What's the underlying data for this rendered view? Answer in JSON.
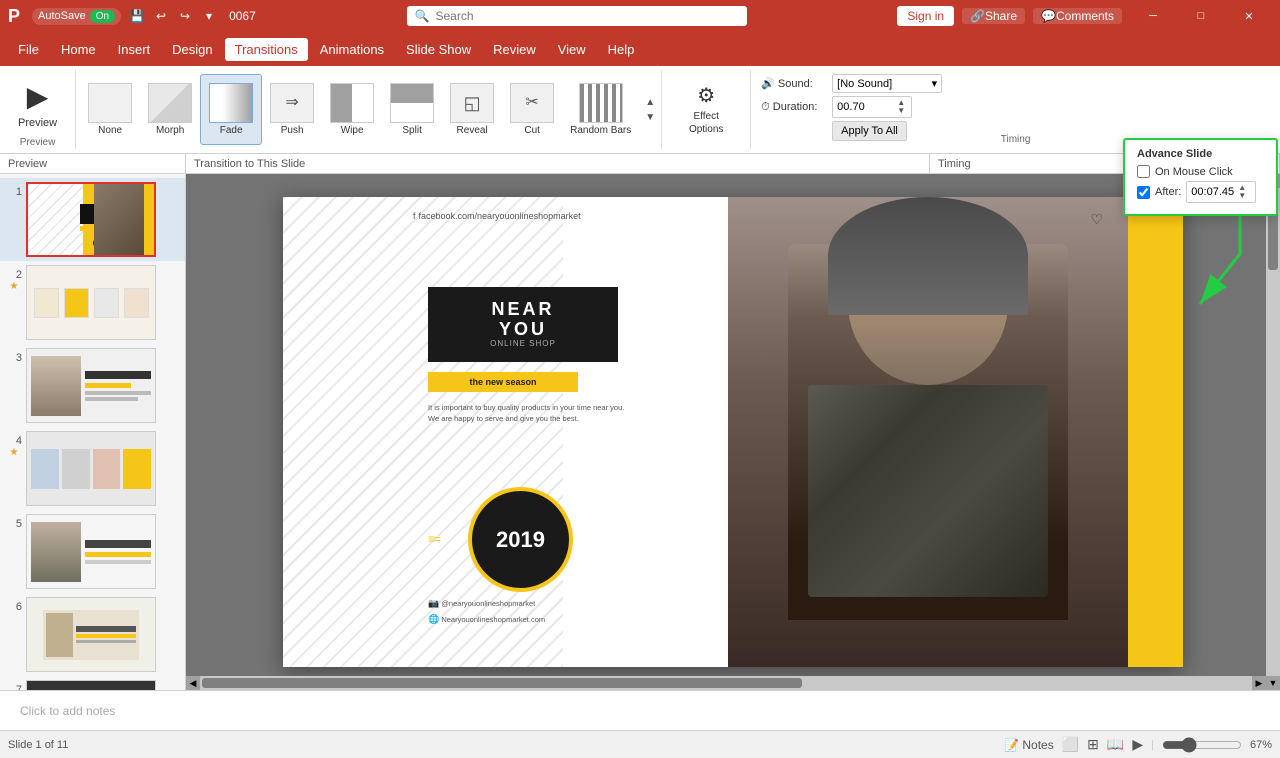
{
  "titleBar": {
    "autosave": "AutoSave",
    "autosave_state": "On",
    "save_icon": "💾",
    "undo_icon": "↩",
    "redo_icon": "↪",
    "customize_icon": "▾",
    "doc_name": "0067",
    "search_placeholder": "Search",
    "sign_in": "Sign in",
    "share": "Share",
    "comments": "Comments"
  },
  "menuBar": {
    "items": [
      {
        "label": "File",
        "active": false
      },
      {
        "label": "Home",
        "active": false
      },
      {
        "label": "Insert",
        "active": false
      },
      {
        "label": "Design",
        "active": false
      },
      {
        "label": "Transitions",
        "active": true
      },
      {
        "label": "Animations",
        "active": false
      },
      {
        "label": "Slide Show",
        "active": false
      },
      {
        "label": "Review",
        "active": false
      },
      {
        "label": "View",
        "active": false
      },
      {
        "label": "Help",
        "active": false
      }
    ]
  },
  "ribbon": {
    "preview_btn": "Preview",
    "preview_icon": "▶",
    "transitions": [
      {
        "name": "None",
        "icon": "⬜"
      },
      {
        "name": "Morph",
        "icon": "◧"
      },
      {
        "name": "Fade",
        "icon": "◫",
        "selected": true
      },
      {
        "name": "Push",
        "icon": "⟹"
      },
      {
        "name": "Wipe",
        "icon": "⊟"
      },
      {
        "name": "Split",
        "icon": "⊞"
      },
      {
        "name": "Reveal",
        "icon": "◱"
      },
      {
        "name": "Cut",
        "icon": "✂"
      },
      {
        "name": "Random Bars",
        "icon": "≡"
      }
    ],
    "effect_options": "Effect Options",
    "sound_label": "Sound:",
    "sound_value": "[No Sound]",
    "duration_label": "Duration:",
    "duration_value": "00.70",
    "apply_all": "Apply To All",
    "advance_slide_title": "Advance Slide",
    "on_mouse_click": "On Mouse Click",
    "after_label": "After:",
    "after_value": "00:07.45",
    "timing_label": "Timing"
  },
  "slidePanel": {
    "slides": [
      {
        "number": "1",
        "starred": false,
        "active": true
      },
      {
        "number": "2",
        "starred": true
      },
      {
        "number": "3",
        "starred": false
      },
      {
        "number": "4",
        "starred": true
      },
      {
        "number": "5",
        "starred": false
      },
      {
        "number": "6",
        "starred": false
      },
      {
        "number": "7",
        "starred": false
      }
    ]
  },
  "slide": {
    "fb_url": "facebook.com/nearyouonlineshopmarket",
    "title_line1": "NEAR",
    "title_line2": "YOU",
    "title_sub": "ONLINE SHOP",
    "season": "the new season",
    "body": "It is important to buy quality products\nin your time near you. We are happy to\nserve and give you the best.",
    "year": "2019",
    "instagram": "@nearyouonlineshopmarket",
    "website": "Nearyouonlineshopmarket.com"
  },
  "sectionLabels": {
    "preview": "Preview",
    "transition_to_slide": "Transition to This Slide",
    "timing": "Timing"
  },
  "notes": {
    "placeholder": "Click to add notes"
  },
  "statusBar": {
    "slide_info": "Slide 1 of 11",
    "notes": "Notes",
    "zoom": "67%"
  }
}
